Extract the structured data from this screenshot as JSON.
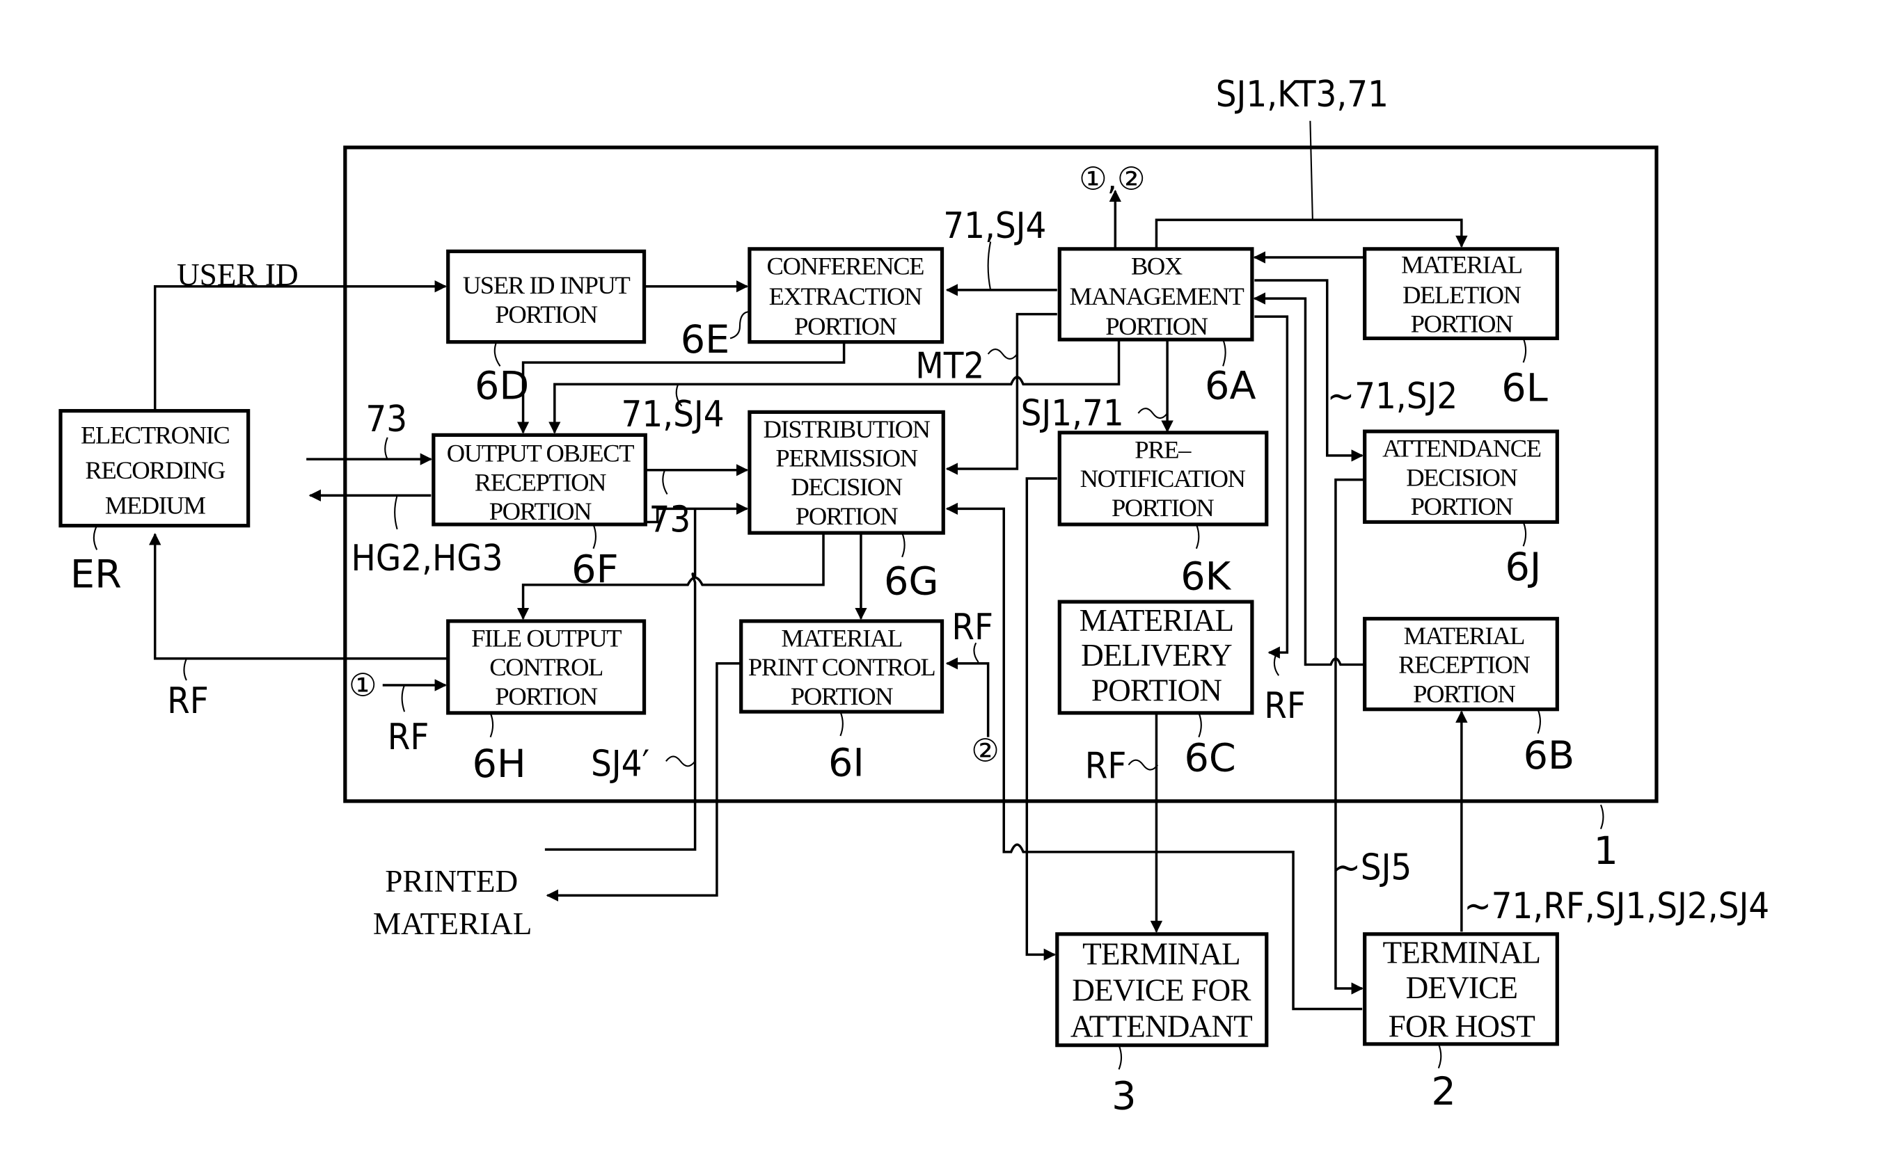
{
  "diagram": {
    "system_ref": "1",
    "external_in_label": "SJ1,KT3,71",
    "top_output_label": "①,②",
    "blocks": {
      "electronic_recording_medium": {
        "lines": [
          "ELECTRONIC",
          "RECORDING",
          "MEDIUM"
        ],
        "ref": "ER"
      },
      "user_id_input": {
        "lines": [
          "USER ID INPUT",
          "PORTION"
        ],
        "ref": "6D"
      },
      "conference_extraction": {
        "lines": [
          "CONFERENCE",
          "EXTRACTION",
          "PORTION"
        ],
        "ref": "6E"
      },
      "box_management": {
        "lines": [
          "BOX",
          "MANAGEMENT",
          "PORTION"
        ],
        "ref": "6A"
      },
      "material_deletion": {
        "lines": [
          "MATERIAL",
          "DELETION",
          "PORTION"
        ],
        "ref": "6L"
      },
      "output_object_reception": {
        "lines": [
          "OUTPUT OBJECT",
          "RECEPTION",
          "PORTION"
        ],
        "ref": "6F"
      },
      "distribution_permission_decision": {
        "lines": [
          "DISTRIBUTION",
          "PERMISSION",
          "DECISION",
          "PORTION"
        ],
        "ref": "6G"
      },
      "pre_notification": {
        "lines": [
          "PRE–",
          "NOTIFICATION",
          "PORTION"
        ],
        "ref": "6K"
      },
      "attendance_decision": {
        "lines": [
          "ATTENDANCE",
          "DECISION",
          "PORTION"
        ],
        "ref": "6J"
      },
      "file_output_control": {
        "lines": [
          "FILE OUTPUT",
          "CONTROL",
          "PORTION"
        ],
        "ref": "6H"
      },
      "material_print_control": {
        "lines": [
          "MATERIAL",
          "PRINT CONTROL",
          "PORTION"
        ],
        "ref": "6I"
      },
      "material_delivery": {
        "lines": [
          "MATERIAL",
          "DELIVERY",
          "PORTION"
        ],
        "ref": "6C"
      },
      "material_reception": {
        "lines": [
          "MATERIAL",
          "RECEPTION",
          "PORTION"
        ],
        "ref": "6B"
      },
      "terminal_attendant": {
        "lines": [
          "TERMINAL",
          "DEVICE FOR",
          "ATTENDANT"
        ],
        "ref": "3"
      },
      "terminal_host": {
        "lines": [
          "TERMINAL",
          "DEVICE",
          "FOR HOST"
        ],
        "ref": "2"
      }
    },
    "signals": {
      "user_id": "USER ID",
      "in_73": "73",
      "hg": "HG2,HG3",
      "rf_er": "RF",
      "circ1": "①",
      "rf_file": "RF",
      "sj4_box_to_conf": "71,SJ4",
      "sj4_to_output": "71,SJ4",
      "mt2": "MT2",
      "out_73": "73",
      "sj1_71": "SJ1,71",
      "sj2_71": "~71,SJ2",
      "rf_print": "RF",
      "circ2": "②",
      "rf_delivery": "RF",
      "rf_to_attendant": "RF",
      "sj4_prime": "SJ4′",
      "sj5": "~SJ5",
      "host_out": "~71,RF,SJ1,SJ2,SJ4",
      "printed_material": [
        "PRINTED",
        "MATERIAL"
      ]
    }
  }
}
